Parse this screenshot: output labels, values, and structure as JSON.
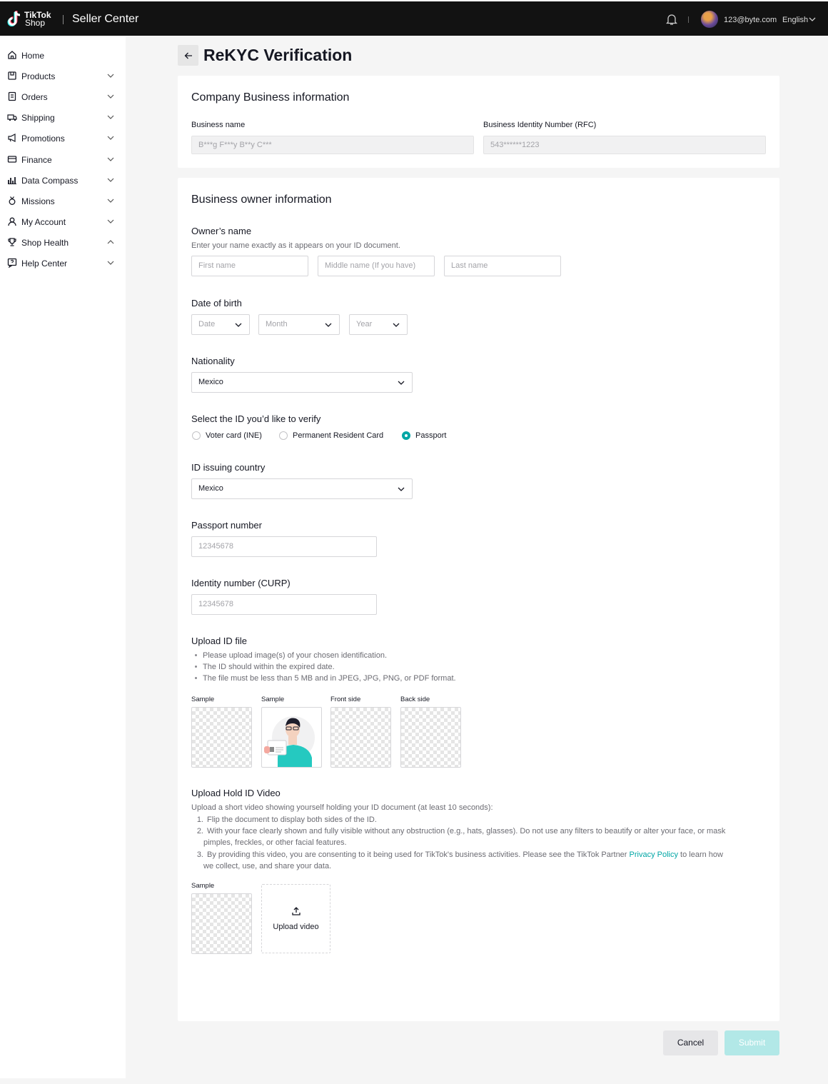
{
  "header": {
    "brand_line1": "TikTok",
    "brand_line2": "Shop",
    "app_title": "Seller Center",
    "user_email": "123@byte.com",
    "language": "English"
  },
  "sidebar": {
    "items": [
      {
        "label": "Home",
        "icon": "home-icon"
      },
      {
        "label": "Products",
        "icon": "products-icon",
        "chevron": "down"
      },
      {
        "label": "Orders",
        "icon": "orders-icon",
        "chevron": "down"
      },
      {
        "label": "Shipping",
        "icon": "shipping-icon",
        "chevron": "down"
      },
      {
        "label": "Promotions",
        "icon": "megaphone-icon",
        "chevron": "down"
      },
      {
        "label": "Finance",
        "icon": "finance-icon",
        "chevron": "down"
      },
      {
        "label": "Data Compass",
        "icon": "chart-icon",
        "chevron": "down"
      },
      {
        "label": "Missions",
        "icon": "medal-icon",
        "chevron": "down"
      },
      {
        "label": "My Account",
        "icon": "user-icon",
        "chevron": "down"
      },
      {
        "label": "Shop Health",
        "icon": "trophy-icon",
        "chevron": "up"
      },
      {
        "label": "Help Center",
        "icon": "help-icon",
        "chevron": "down"
      }
    ]
  },
  "page": {
    "title": "ReKYC Verification"
  },
  "company": {
    "title": "Company Business information",
    "business_name_label": "Business name",
    "business_name_value": "B***g F***y B**y C***",
    "rfc_label": "Business Identity Number (RFC)",
    "rfc_value": "543******1223"
  },
  "owner": {
    "title": "Business owner information",
    "name_label": "Owner’s name",
    "name_hint": "Enter your name exactly as it appears on your ID document.",
    "first_name_placeholder": "First name",
    "middle_name_placeholder": "Middle name (If you have)",
    "last_name_placeholder": "Last name",
    "dob_label": "Date of birth",
    "dob_date": "Date",
    "dob_month": "Month",
    "dob_year": "Year",
    "nationality_label": "Nationality",
    "nationality_value": "Mexico",
    "id_select_label": "Select the ID you’d like to verify",
    "id_options": [
      "Voter card (INE)",
      "Permanent Resident Card",
      "Passport"
    ],
    "id_selected": "Passport",
    "issuing_country_label": "ID issuing country",
    "issuing_country_value": "Mexico",
    "passport_label": "Passport number",
    "passport_placeholder": "12345678",
    "curp_label": "Identity number (CURP)",
    "curp_placeholder": "12345678"
  },
  "upload_id": {
    "title": "Upload ID file",
    "bullets": [
      "Please upload image(s) of your chosen identification.",
      "The ID should within the expired date.",
      "The file must be less than 5 MB and in JPEG, JPG, PNG, or PDF format."
    ],
    "thumb_labels": [
      "Sample",
      "Sample",
      "Front side",
      "Back side"
    ]
  },
  "upload_video": {
    "title": "Upload Hold ID Video",
    "intro": "Upload a short video showing yourself holding your ID document (at least 10 seconds):",
    "item1": "Flip the document to display both sides of the ID.",
    "item2_line1": "With your face clearly shown and fully visible without any obstruction (e.g., hats, glasses). Do not use any filters to beautify or alter your face, or mask",
    "item2_line2": "pimples, freckles, or other facial features.",
    "item3_line1_before": "By providing this video, you are consenting to it being used for TikTok's business activities. Please see the TikTok Partner ",
    "item3_link": "Privacy Policy",
    "item3_line1_after": " to learn how",
    "item3_line2": "we collect, use, and share your data.",
    "sample_label": "Sample",
    "upload_label": "Upload video"
  },
  "actions": {
    "cancel": "Cancel",
    "submit": "Submit"
  },
  "colors": {
    "accent": "#00a6a5",
    "topbar": "#121212",
    "submit_disabled": "#b2e8e7"
  }
}
